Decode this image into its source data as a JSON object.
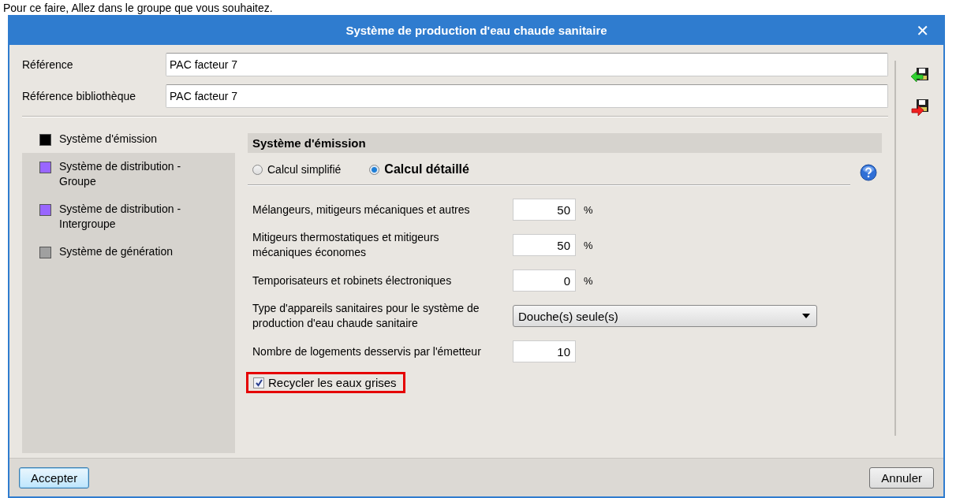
{
  "caption": "Pour ce faire, Allez dans le groupe que vous souhaitez.",
  "window": {
    "title": "Système de production d'eau chaude sanitaire",
    "close": "✕"
  },
  "references": [
    {
      "label": "Référence",
      "value": "PAC facteur 7"
    },
    {
      "label": "Référence bibliothèque",
      "value": "PAC facteur 7"
    }
  ],
  "sidebar": {
    "items": [
      {
        "label": "Système d'émission",
        "color": "#000000",
        "selected": true
      },
      {
        "label": "Système de distribution - Groupe",
        "color": "#9966ff",
        "selected": false
      },
      {
        "label": "Système de distribution - Intergroupe",
        "color": "#9966ff",
        "selected": false
      },
      {
        "label": "Système de génération",
        "color": "#a0a0a0",
        "selected": false
      }
    ]
  },
  "section": {
    "title": "Système d'émission",
    "modes": [
      {
        "label": "Calcul simplifié",
        "selected": false
      },
      {
        "label": "Calcul détaillé",
        "selected": true
      }
    ],
    "fields": [
      {
        "kind": "number",
        "label": "Mélangeurs, mitigeurs mécaniques et autres",
        "value": "50",
        "unit": "%"
      },
      {
        "kind": "number",
        "label": "Mitigeurs thermostatiques et mitigeurs mécaniques économes",
        "value": "50",
        "unit": "%"
      },
      {
        "kind": "number",
        "label": "Temporisateurs et robinets électroniques",
        "value": "0",
        "unit": "%"
      },
      {
        "kind": "select",
        "label": "Type d'appareils sanitaires pour le système de production d'eau chaude sanitaire",
        "value": "Douche(s) seule(s)"
      },
      {
        "kind": "number",
        "label": "Nombre de logements desservis par l'émetteur",
        "value": "10"
      }
    ],
    "checkbox": {
      "label": "Recycler les eaux grises",
      "checked": true,
      "highlighted": true
    }
  },
  "buttons": [
    {
      "label": "Accepter",
      "default": true
    },
    {
      "label": "Annuler",
      "default": false
    }
  ]
}
